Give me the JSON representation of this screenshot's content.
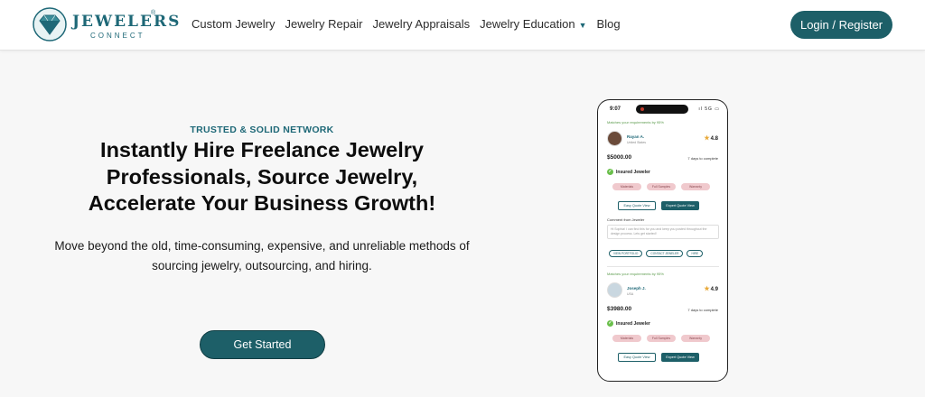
{
  "header": {
    "logo": {
      "line1": "JEWELERS",
      "line2": "CONNECT",
      "reg": "®"
    },
    "nav": [
      "Custom Jewelry",
      "Jewelry Repair",
      "Jewelry Appraisals",
      "Jewelry Education",
      "Blog"
    ],
    "login_label": "Login / Register"
  },
  "hero": {
    "eyebrow": "TRUSTED & SOLID NETWORK",
    "headline": "Instantly Hire Freelance Jewelry Professionals, Source Jewelry, Accelerate Your Business Growth!",
    "subtitle": "Move beyond the old, time-consuming, expensive, and unreliable methods of sourcing jewelry, outsourcing, and hiring.",
    "cta_label": "Get Started"
  },
  "phone": {
    "time": "9:07",
    "status": "ıl 5G ▭",
    "card1": {
      "match": "Matches your requirements by 95%",
      "name": "Rayan A.",
      "location": "United States",
      "rating": "4.8",
      "price": "$5000.00",
      "days": "7 days to complete",
      "insured": "Insured Jeweler",
      "chips": [
        "Materials",
        "Full Samples",
        "Warranty"
      ],
      "btn_outline": "Easy Quote View",
      "btn_fill": "Expert Quote View",
      "comment_label": "Comment from Jeweler",
      "comment_text": "Hi Sophia! I can find this for you and keep you posted throughout the design process. Lets get started!",
      "pills": [
        "VIEW PORTFOLIO",
        "CONTACT JEWELER",
        "HIRE"
      ]
    },
    "card2": {
      "match": "Matches your requirements by 95%",
      "name": "Joseph J.",
      "location": "USA",
      "rating": "4.9",
      "price": "$3980.00",
      "days": "7 days to complete",
      "insured": "Insured Jeweler",
      "chips": [
        "Materials",
        "Full Samples",
        "Warranty"
      ],
      "btn_outline": "Easy Quote View",
      "btn_fill": "Expert Quote View"
    }
  },
  "colors": {
    "brand": "#1d5f68",
    "match_green": "#5a9a4b",
    "chip_pink": "#f0c9cd",
    "star": "#e8a93a"
  }
}
